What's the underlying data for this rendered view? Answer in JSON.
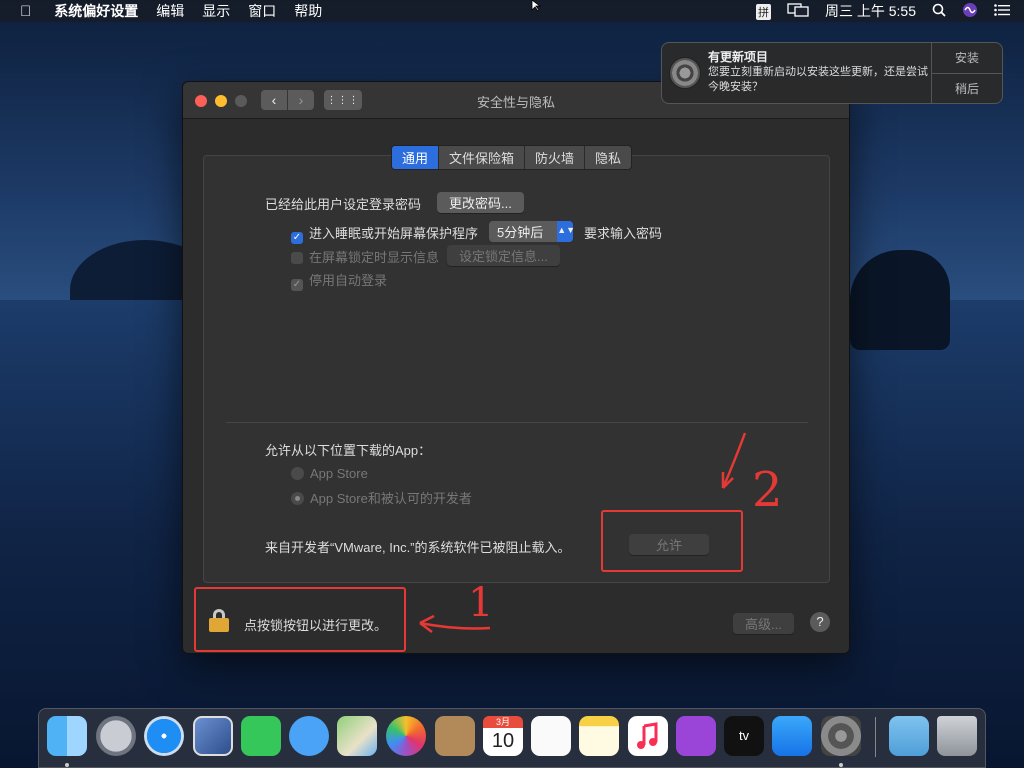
{
  "menubar": {
    "apple": "",
    "items": [
      "系统偏好设置",
      "编辑",
      "显示",
      "窗口",
      "帮助"
    ],
    "ime": "拼",
    "clock": "周三 上午 5:55"
  },
  "notification": {
    "title": "有更新项目",
    "body": "您要立刻重新启动以安装这些更新，还是尝试今晚安装？",
    "install_label": "安装",
    "later_label": "稍后"
  },
  "window": {
    "title": "安全性与隐私",
    "nav_back": "‹",
    "nav_forward": "›",
    "grid": "⋮⋮⋮",
    "tabs": [
      {
        "label": "通用",
        "active": true
      },
      {
        "label": "文件保险箱",
        "active": false
      },
      {
        "label": "防火墙",
        "active": false
      },
      {
        "label": "隐私",
        "active": false
      }
    ],
    "general": {
      "password_set_label": "已经给此用户设定登录密码",
      "change_password_button": "更改密码...",
      "require_password_label": "进入睡眠或开始屏幕保护程序",
      "require_password_checked": true,
      "delay_value": "5分钟后",
      "require_password_suffix": "要求输入密码",
      "show_message_label": "在屏幕锁定时显示信息",
      "set_lock_message_button": "设定锁定信息...",
      "disable_autologin_label": "停用自动登录",
      "allow_apps_label": "允许从以下位置下载的App：",
      "radio_options": [
        {
          "label": "App Store",
          "selected": false
        },
        {
          "label": "App Store和被认可的开发者",
          "selected": true
        }
      ],
      "blocked_message": "来自开发者“VMware, Inc.”的系统软件已被阻止载入。",
      "allow_button": "允许"
    },
    "lock_message": "点按锁按钮以进行更改。",
    "advanced_button": "高级...",
    "help_button": "?"
  },
  "annotations": {
    "label_one": "1",
    "label_two": "2",
    "color": "#e53935"
  },
  "dock": {
    "apps": [
      "finder-icon",
      "launchpad-icon",
      "safari-icon",
      "mail-icon",
      "facetime-icon",
      "messages-icon",
      "maps-icon",
      "photos-icon",
      "contacts-icon",
      "calendar-icon",
      "reminders-icon",
      "notes-icon",
      "music-icon",
      "podcasts-icon",
      "tv-icon",
      "app-store-icon",
      "system-preferences-icon",
      "downloads-icon",
      "trash-icon"
    ],
    "calendar_month": "3月",
    "calendar_day": "10",
    "tv_label": "tv"
  }
}
